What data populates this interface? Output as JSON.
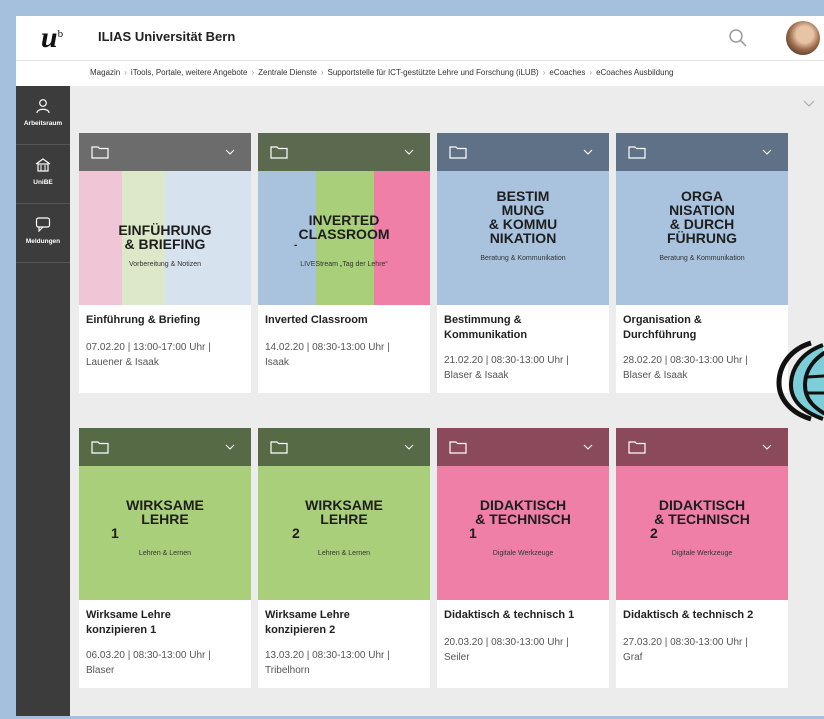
{
  "header": {
    "logo": "u",
    "logo_sup": "b",
    "title": "ILIAS Universität Bern"
  },
  "breadcrumb": [
    "Magazin",
    "iTools, Portale, weitere Angebote",
    "Zentrale Dienste",
    "Supportstelle für ICT-gestützte Lehre und Forschung (iLUB)",
    "eCoaches",
    "eCoaches Ausbildung"
  ],
  "sidebar": [
    {
      "label": "Arbeitsraum",
      "icon": "person-icon"
    },
    {
      "label": "UniBE",
      "icon": "building-icon"
    },
    {
      "label": "Meldungen",
      "icon": "chat-icon"
    }
  ],
  "tiles": [
    {
      "head_color": "#6c6c6c",
      "card_lines": [
        "EINFÜHRUNG",
        "& BRIEFING"
      ],
      "card_sub": "Vorbereitung & Notizen",
      "name_lines": [
        "Einführung & Briefing"
      ],
      "meta_lines": [
        "07.02.20 | 13:00-17:00 Uhr |",
        "Lauener & Isaak"
      ]
    },
    {
      "head_color": "#5b6a4e",
      "card_lines": [
        "INVERTED",
        "CLASSROOM"
      ],
      "card_extra": "-",
      "card_sub": "LIVEStream „Tag der Lehre“",
      "name_lines": [
        "Inverted Classroom"
      ],
      "meta_lines": [
        "14.02.20 | 08:30-13:00 Uhr |",
        "Isaak"
      ]
    },
    {
      "head_color": "#5f7186",
      "card_lines": [
        "BESTIM",
        "MUNG",
        "& KOMMU",
        "NIKATION"
      ],
      "card_sub": "Beratung & Kommunikation",
      "name_lines": [
        "Bestimmung &",
        "Kommunikation"
      ],
      "meta_lines": [
        "21.02.20 | 08:30-13:00 Uhr |",
        "Blaser & Isaak"
      ]
    },
    {
      "head_color": "#5f7186",
      "card_lines": [
        "ORGA",
        "NISATION",
        "& DURCH",
        "FÜHRUNG"
      ],
      "card_sub": "Beratung & Kommunikation",
      "name_lines": [
        "Organisation &",
        "Durchführung"
      ],
      "meta_lines": [
        "28.02.20 | 08:30-13:00 Uhr |",
        "Blaser & Isaak"
      ]
    },
    {
      "head_color": "#566b45",
      "card_lines": [
        "WIRKSAME",
        "LEHRE",
        "1"
      ],
      "card_sub": "Lehren & Lernen",
      "name_lines": [
        "Wirksame Lehre",
        "konzipieren 1"
      ],
      "meta_lines": [
        "06.03.20 | 08:30-13:00 Uhr |",
        "Blaser"
      ]
    },
    {
      "head_color": "#566b45",
      "card_lines": [
        "WIRKSAME",
        "LEHRE",
        "2"
      ],
      "card_sub": "Lehren & Lernen",
      "name_lines": [
        "Wirksame Lehre",
        "konzipieren 2"
      ],
      "meta_lines": [
        "13.03.20 | 08:30-13:00 Uhr |",
        "Tribelhorn"
      ]
    },
    {
      "head_color": "#8b4a5c",
      "card_lines": [
        "DIDAKTISCH",
        "& TECHNISCH",
        "1"
      ],
      "card_sub": "Digitale Werkzeuge",
      "name_lines": [
        "Didaktisch & technisch 1"
      ],
      "meta_lines": [
        "20.03.20 | 08:30-13:00 Uhr |",
        "Seiler"
      ]
    },
    {
      "head_color": "#8b4a5c",
      "card_lines": [
        "DIDAKTISCH",
        "& TECHNISCH",
        "2"
      ],
      "card_sub": "Digitale Werkzeuge",
      "name_lines": [
        "Didaktisch & technisch 2"
      ],
      "meta_lines": [
        "27.03.20 | 08:30-13:00 Uhr |",
        "Graf"
      ]
    }
  ],
  "colors": {
    "pink": "#f0c6d6",
    "lightgreen": "#dde8c8",
    "lightblue": "#d6e2ee",
    "blue": "#a9c3df",
    "green": "#a9cf7b",
    "magenta": "#ef7fa7",
    "bottom_strip": [
      "#8b4a5c",
      "#566b45",
      "#8b4a5c",
      "#566b45"
    ]
  }
}
